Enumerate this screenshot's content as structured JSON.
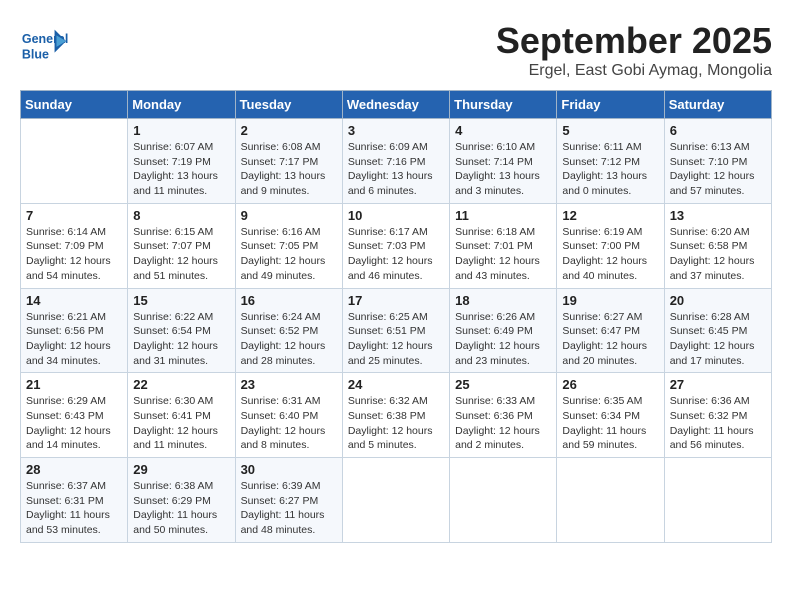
{
  "header": {
    "logo_text_general": "General",
    "logo_text_blue": "Blue",
    "month_title": "September 2025",
    "subtitle": "Ergel, East Gobi Aymag, Mongolia"
  },
  "weekdays": [
    "Sunday",
    "Monday",
    "Tuesday",
    "Wednesday",
    "Thursday",
    "Friday",
    "Saturday"
  ],
  "weeks": [
    [
      {
        "day": "",
        "sunrise": "",
        "sunset": "",
        "daylight": ""
      },
      {
        "day": "1",
        "sunrise": "Sunrise: 6:07 AM",
        "sunset": "Sunset: 7:19 PM",
        "daylight": "Daylight: 13 hours and 11 minutes."
      },
      {
        "day": "2",
        "sunrise": "Sunrise: 6:08 AM",
        "sunset": "Sunset: 7:17 PM",
        "daylight": "Daylight: 13 hours and 9 minutes."
      },
      {
        "day": "3",
        "sunrise": "Sunrise: 6:09 AM",
        "sunset": "Sunset: 7:16 PM",
        "daylight": "Daylight: 13 hours and 6 minutes."
      },
      {
        "day": "4",
        "sunrise": "Sunrise: 6:10 AM",
        "sunset": "Sunset: 7:14 PM",
        "daylight": "Daylight: 13 hours and 3 minutes."
      },
      {
        "day": "5",
        "sunrise": "Sunrise: 6:11 AM",
        "sunset": "Sunset: 7:12 PM",
        "daylight": "Daylight: 13 hours and 0 minutes."
      },
      {
        "day": "6",
        "sunrise": "Sunrise: 6:13 AM",
        "sunset": "Sunset: 7:10 PM",
        "daylight": "Daylight: 12 hours and 57 minutes."
      }
    ],
    [
      {
        "day": "7",
        "sunrise": "Sunrise: 6:14 AM",
        "sunset": "Sunset: 7:09 PM",
        "daylight": "Daylight: 12 hours and 54 minutes."
      },
      {
        "day": "8",
        "sunrise": "Sunrise: 6:15 AM",
        "sunset": "Sunset: 7:07 PM",
        "daylight": "Daylight: 12 hours and 51 minutes."
      },
      {
        "day": "9",
        "sunrise": "Sunrise: 6:16 AM",
        "sunset": "Sunset: 7:05 PM",
        "daylight": "Daylight: 12 hours and 49 minutes."
      },
      {
        "day": "10",
        "sunrise": "Sunrise: 6:17 AM",
        "sunset": "Sunset: 7:03 PM",
        "daylight": "Daylight: 12 hours and 46 minutes."
      },
      {
        "day": "11",
        "sunrise": "Sunrise: 6:18 AM",
        "sunset": "Sunset: 7:01 PM",
        "daylight": "Daylight: 12 hours and 43 minutes."
      },
      {
        "day": "12",
        "sunrise": "Sunrise: 6:19 AM",
        "sunset": "Sunset: 7:00 PM",
        "daylight": "Daylight: 12 hours and 40 minutes."
      },
      {
        "day": "13",
        "sunrise": "Sunrise: 6:20 AM",
        "sunset": "Sunset: 6:58 PM",
        "daylight": "Daylight: 12 hours and 37 minutes."
      }
    ],
    [
      {
        "day": "14",
        "sunrise": "Sunrise: 6:21 AM",
        "sunset": "Sunset: 6:56 PM",
        "daylight": "Daylight: 12 hours and 34 minutes."
      },
      {
        "day": "15",
        "sunrise": "Sunrise: 6:22 AM",
        "sunset": "Sunset: 6:54 PM",
        "daylight": "Daylight: 12 hours and 31 minutes."
      },
      {
        "day": "16",
        "sunrise": "Sunrise: 6:24 AM",
        "sunset": "Sunset: 6:52 PM",
        "daylight": "Daylight: 12 hours and 28 minutes."
      },
      {
        "day": "17",
        "sunrise": "Sunrise: 6:25 AM",
        "sunset": "Sunset: 6:51 PM",
        "daylight": "Daylight: 12 hours and 25 minutes."
      },
      {
        "day": "18",
        "sunrise": "Sunrise: 6:26 AM",
        "sunset": "Sunset: 6:49 PM",
        "daylight": "Daylight: 12 hours and 23 minutes."
      },
      {
        "day": "19",
        "sunrise": "Sunrise: 6:27 AM",
        "sunset": "Sunset: 6:47 PM",
        "daylight": "Daylight: 12 hours and 20 minutes."
      },
      {
        "day": "20",
        "sunrise": "Sunrise: 6:28 AM",
        "sunset": "Sunset: 6:45 PM",
        "daylight": "Daylight: 12 hours and 17 minutes."
      }
    ],
    [
      {
        "day": "21",
        "sunrise": "Sunrise: 6:29 AM",
        "sunset": "Sunset: 6:43 PM",
        "daylight": "Daylight: 12 hours and 14 minutes."
      },
      {
        "day": "22",
        "sunrise": "Sunrise: 6:30 AM",
        "sunset": "Sunset: 6:41 PM",
        "daylight": "Daylight: 12 hours and 11 minutes."
      },
      {
        "day": "23",
        "sunrise": "Sunrise: 6:31 AM",
        "sunset": "Sunset: 6:40 PM",
        "daylight": "Daylight: 12 hours and 8 minutes."
      },
      {
        "day": "24",
        "sunrise": "Sunrise: 6:32 AM",
        "sunset": "Sunset: 6:38 PM",
        "daylight": "Daylight: 12 hours and 5 minutes."
      },
      {
        "day": "25",
        "sunrise": "Sunrise: 6:33 AM",
        "sunset": "Sunset: 6:36 PM",
        "daylight": "Daylight: 12 hours and 2 minutes."
      },
      {
        "day": "26",
        "sunrise": "Sunrise: 6:35 AM",
        "sunset": "Sunset: 6:34 PM",
        "daylight": "Daylight: 11 hours and 59 minutes."
      },
      {
        "day": "27",
        "sunrise": "Sunrise: 6:36 AM",
        "sunset": "Sunset: 6:32 PM",
        "daylight": "Daylight: 11 hours and 56 minutes."
      }
    ],
    [
      {
        "day": "28",
        "sunrise": "Sunrise: 6:37 AM",
        "sunset": "Sunset: 6:31 PM",
        "daylight": "Daylight: 11 hours and 53 minutes."
      },
      {
        "day": "29",
        "sunrise": "Sunrise: 6:38 AM",
        "sunset": "Sunset: 6:29 PM",
        "daylight": "Daylight: 11 hours and 50 minutes."
      },
      {
        "day": "30",
        "sunrise": "Sunrise: 6:39 AM",
        "sunset": "Sunset: 6:27 PM",
        "daylight": "Daylight: 11 hours and 48 minutes."
      },
      {
        "day": "",
        "sunrise": "",
        "sunset": "",
        "daylight": ""
      },
      {
        "day": "",
        "sunrise": "",
        "sunset": "",
        "daylight": ""
      },
      {
        "day": "",
        "sunrise": "",
        "sunset": "",
        "daylight": ""
      },
      {
        "day": "",
        "sunrise": "",
        "sunset": "",
        "daylight": ""
      }
    ]
  ]
}
